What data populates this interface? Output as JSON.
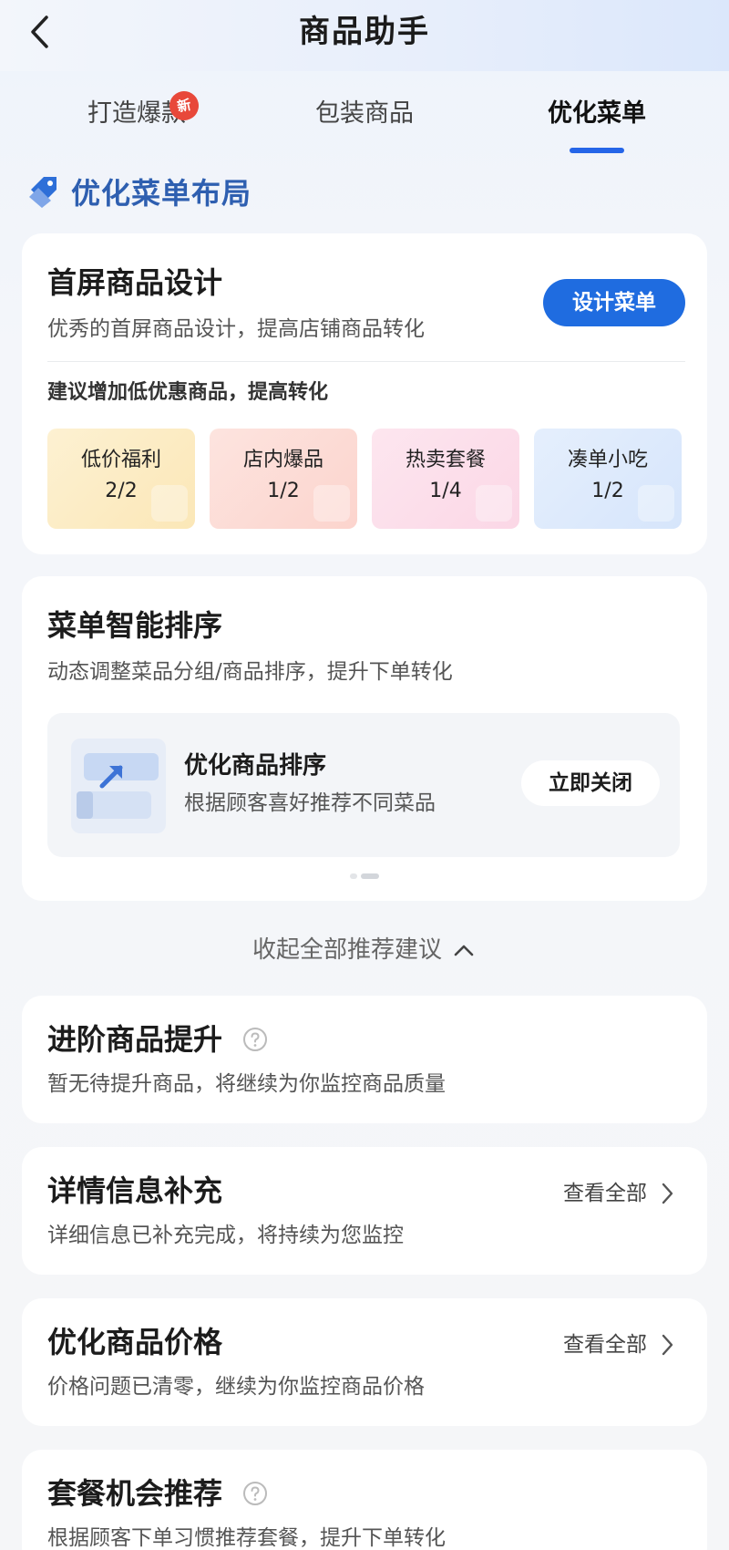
{
  "header": {
    "title": "商品助手",
    "back_icon": "chevron-left-icon"
  },
  "tabs": [
    {
      "label": "打造爆款",
      "badge": "新",
      "active": false
    },
    {
      "label": "包装商品",
      "active": false
    },
    {
      "label": "优化菜单",
      "active": true
    }
  ],
  "section": {
    "title": "优化菜单布局",
    "icon": "tag-icon",
    "accent": "#2e5fb0"
  },
  "first_screen": {
    "title": "首屏商品设计",
    "desc": "优秀的首屏商品设计，提高店铺商品转化",
    "button": "设计菜单",
    "suggestion": "建议增加低优惠商品，提高转化",
    "tiles": [
      {
        "name": "低价福利",
        "count": "2/2"
      },
      {
        "name": "店内爆品",
        "count": "1/2"
      },
      {
        "name": "热卖套餐",
        "count": "1/4"
      },
      {
        "name": "凑单小吃",
        "count": "1/2"
      }
    ]
  },
  "smart_sort": {
    "title": "菜单智能排序",
    "desc": "动态调整菜品分组/商品排序，提升下单转化",
    "item_title": "优化商品排序",
    "item_desc": "根据顾客喜好推荐不同菜品",
    "button": "立即关闭"
  },
  "collapse": {
    "label": "收起全部推荐建议",
    "icon": "chevron-up-icon"
  },
  "cards": {
    "advanced": {
      "title": "进阶商品提升",
      "desc": "暂无待提升商品，将继续为你监控商品质量"
    },
    "details": {
      "title": "详情信息补充",
      "desc": "详细信息已补充完成，将持续为您监控",
      "link": "查看全部"
    },
    "price": {
      "title": "优化商品价格",
      "desc": "价格问题已清零，继续为你监控商品价格",
      "link": "查看全部"
    },
    "combo": {
      "title": "套餐机会推荐",
      "desc": "根据顾客下单习惯推荐套餐，提升下单转化"
    }
  },
  "colors": {
    "primary": "#1f6ce0",
    "badge": "#e8483a"
  }
}
